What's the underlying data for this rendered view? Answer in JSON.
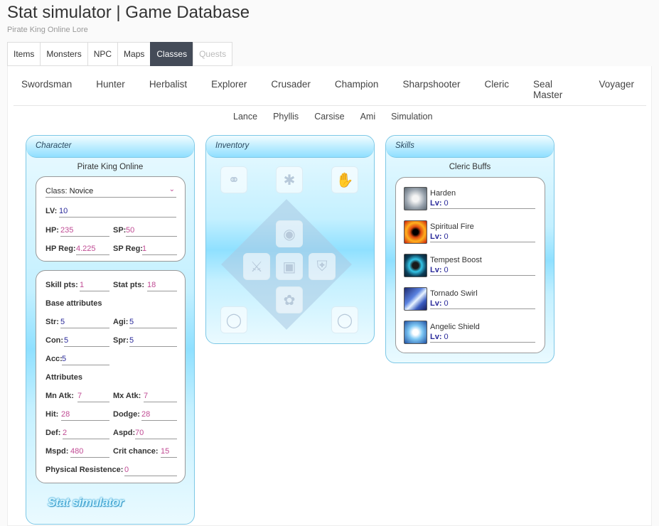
{
  "header": {
    "title": "Stat simulator | Game Database",
    "subtitle": "Pirate King Online Lore"
  },
  "main_tabs": [
    {
      "label": "Items"
    },
    {
      "label": "Monsters"
    },
    {
      "label": "NPC"
    },
    {
      "label": "Maps"
    },
    {
      "label": "Classes",
      "active": true
    },
    {
      "label": "Quests",
      "disabled": true
    }
  ],
  "class_nav": [
    "Swordsman",
    "Hunter",
    "Herbalist",
    "Explorer",
    "Crusader",
    "Champion",
    "Sharpshooter",
    "Cleric",
    "Seal Master",
    "Voyager"
  ],
  "sub_nav": [
    "Lance",
    "Phyllis",
    "Carsise",
    "Ami",
    "Simulation"
  ],
  "character": {
    "header": "Character",
    "subtitle": "Pirate King Online",
    "class_label": "Class:",
    "class_value": "Novice",
    "lv_label": "LV:",
    "lv": "10",
    "hp_label": "HP:",
    "hp": "235",
    "sp_label": "SP:",
    "sp": "50",
    "hpreg_label": "HP Reg:",
    "hpreg": "4.225",
    "spreg_label": "SP Reg:",
    "spreg": "1",
    "skillpts_label": "Skill pts:",
    "skillpts": "1",
    "statpts_label": "Stat pts:",
    "statpts": "18",
    "base_label": "Base attributes",
    "str_label": "Str:",
    "str": "5",
    "agi_label": "Agi:",
    "agi": "5",
    "con_label": "Con:",
    "con": "5",
    "spr_label": "Spr:",
    "spr": "5",
    "acc_label": "Acc:",
    "acc": "5",
    "attr_label": "Attributes",
    "mnatk_label": "Mn Atk:",
    "mnatk": "7",
    "mxatk_label": "Mx Atk:",
    "mxatk": "7",
    "hit_label": "Hit:",
    "hit": "28",
    "dodge_label": "Dodge:",
    "dodge": "28",
    "def_label": "Def:",
    "def": "2",
    "aspd_label": "Aspd:",
    "aspd": "70",
    "mspd_label": "Mspd:",
    "mspd": "480",
    "crit_label": "Crit chance:",
    "crit": "15",
    "pr_label": "Physical Resistence:",
    "pr": "0",
    "brand": "Stat simulator"
  },
  "inventory": {
    "header": "Inventory"
  },
  "skills": {
    "header": "Skills",
    "subtitle": "Cleric Buffs",
    "lv_label": "Lv:",
    "list": [
      {
        "name": "Harden",
        "lv": "0"
      },
      {
        "name": "Spiritual Fire",
        "lv": "0"
      },
      {
        "name": "Tempest Boost",
        "lv": "0"
      },
      {
        "name": "Tornado Swirl",
        "lv": "0"
      },
      {
        "name": "Angelic Shield",
        "lv": "0"
      }
    ]
  },
  "colors": {
    "tab_active": "#444b58",
    "value_pink": "#c04b94",
    "value_blue": "#2a2a9a",
    "panel_border": "#7dc8e6"
  }
}
